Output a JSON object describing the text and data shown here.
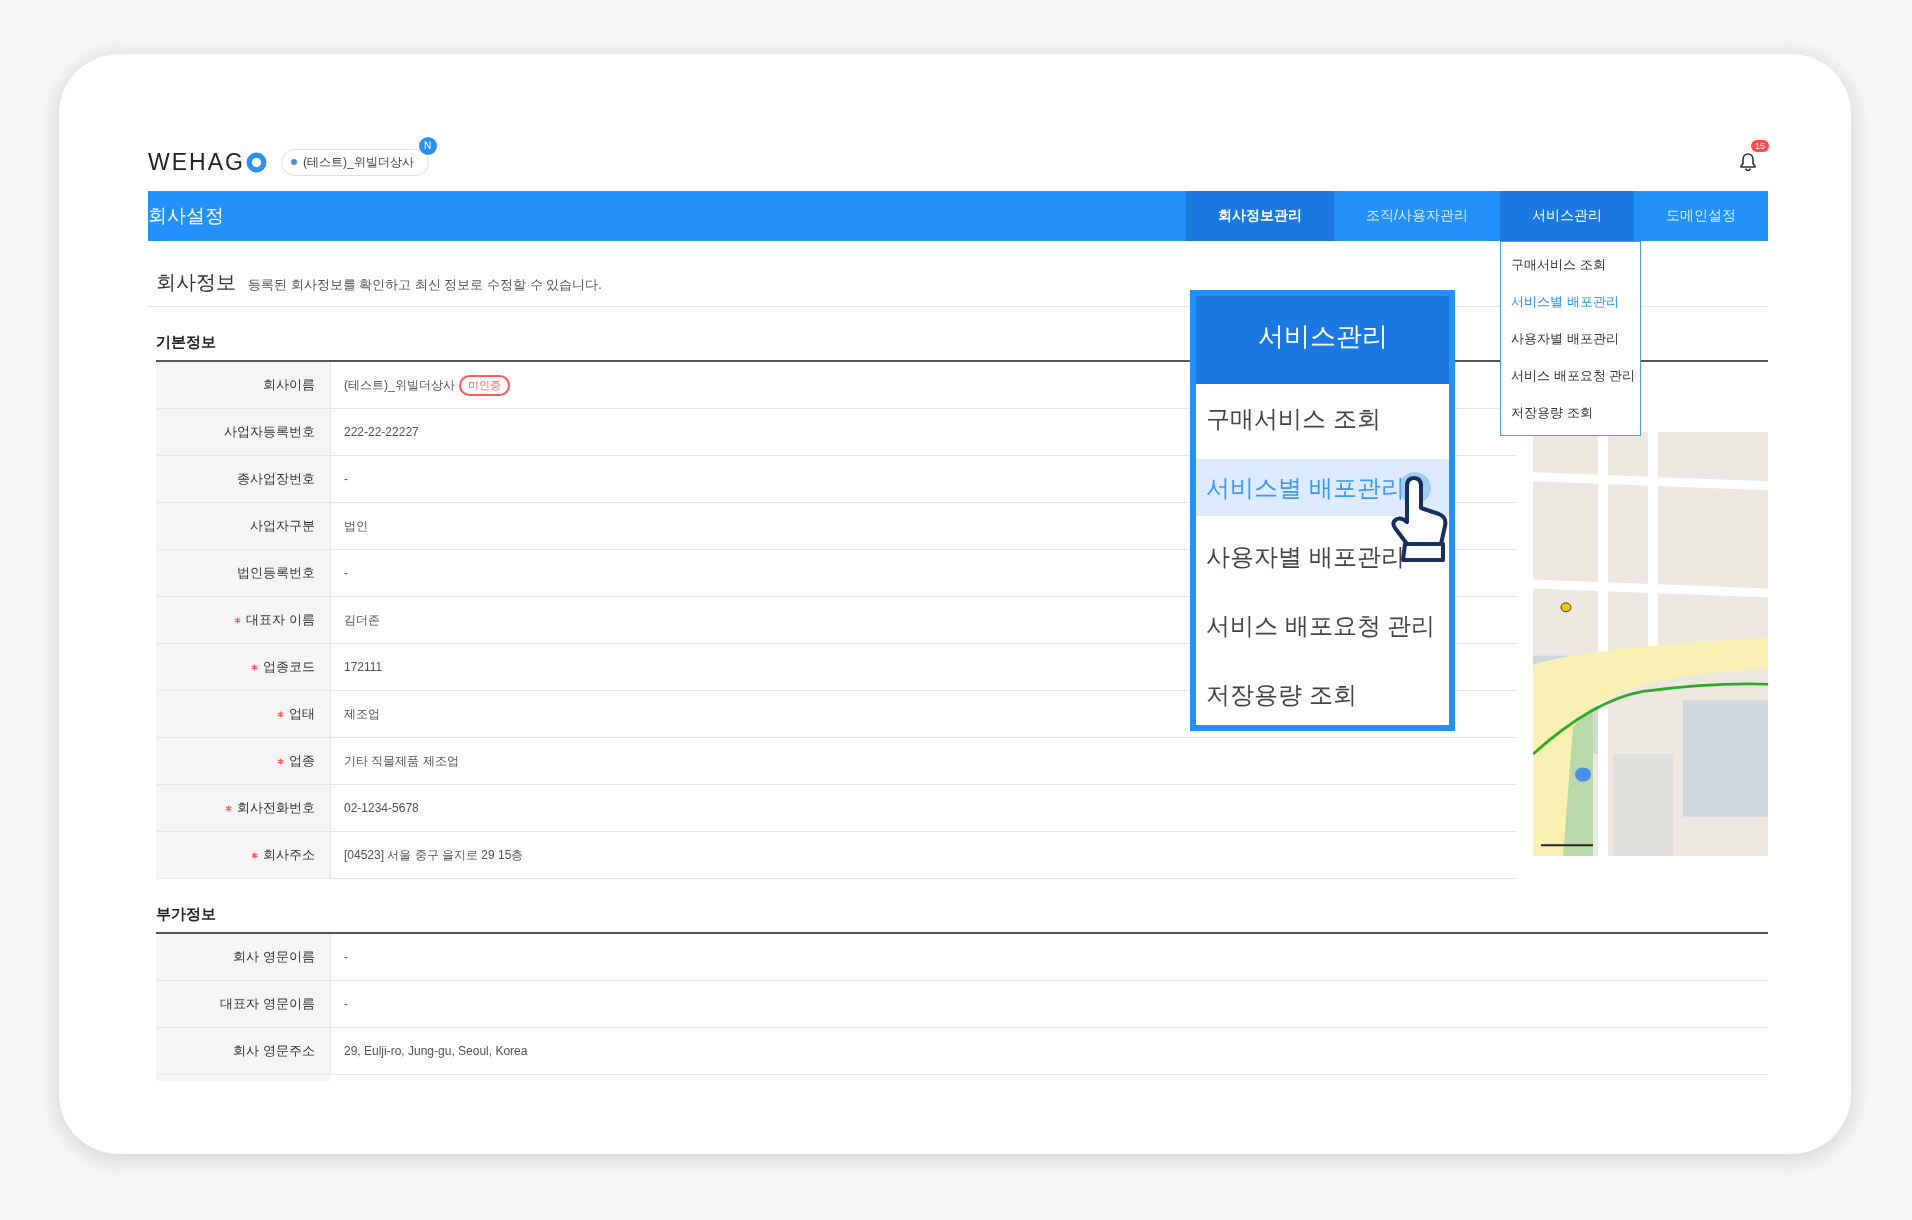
{
  "header": {
    "logo": "WEHAG",
    "company": "(테스트)_위빌더상사",
    "company_badge": "N",
    "notification_count": "15"
  },
  "title_bar": {
    "title": "회사설정",
    "tabs": [
      {
        "label": "회사정보관리",
        "selected": true,
        "expanded": false
      },
      {
        "label": "조직/사용자관리",
        "selected": false,
        "expanded": false
      },
      {
        "label": "서비스관리",
        "selected": false,
        "expanded": true,
        "items": [
          {
            "label": "구매서비스 조회",
            "selected": false
          },
          {
            "label": "서비스별 배포관리",
            "selected": true
          },
          {
            "label": "사용자별 배포관리",
            "selected": false
          },
          {
            "label": "서비스 배포요청 관리",
            "selected": false
          },
          {
            "label": "저장용량 조회",
            "selected": false
          }
        ]
      },
      {
        "label": "도메인설정",
        "selected": false,
        "expanded": false
      }
    ]
  },
  "page": {
    "title": "회사정보",
    "description": "등록된 회사정보를 확인하고 최신 정보로 수정할 수 있습니다."
  },
  "sections": [
    {
      "title": "기본정보",
      "map": true,
      "rows": [
        {
          "label": "회사이름",
          "value": "(테스트)_위빌더상사",
          "required": false,
          "badge": "미인증"
        },
        {
          "label": "사업자등록번호",
          "value": "222-22-22227",
          "required": false
        },
        {
          "label": "종사업장번호",
          "value": "-",
          "required": false
        },
        {
          "label": "사업자구분",
          "value": "법인",
          "required": false
        },
        {
          "label": "법인등록번호",
          "value": "-",
          "required": false
        },
        {
          "label": "대표자 이름",
          "value": "김더존",
          "required": true
        },
        {
          "label": "업종코드",
          "value": "172111",
          "required": true
        },
        {
          "label": "업태",
          "value": "제조업",
          "required": true
        },
        {
          "label": "업종",
          "value": "기타 직물제품 제조업",
          "required": true
        },
        {
          "label": "회사전화번호",
          "value": "02-1234-5678",
          "required": true
        },
        {
          "label": "회사주소",
          "value": "[04523] 서울 중구 을지로 29 15층",
          "required": true
        }
      ]
    },
    {
      "title": "부가정보",
      "map": false,
      "rows": [
        {
          "label": "회사 영문이름",
          "value": "-",
          "required": false
        },
        {
          "label": "대표자 영문이름",
          "value": "-",
          "required": false
        },
        {
          "label": "회사 영문주소",
          "value": "29, Eulji-ro, Jung-gu, Seoul, Korea",
          "required": false
        }
      ]
    }
  ],
  "callout": {
    "title": "서비스관리",
    "items": [
      {
        "label": "구매서비스 조회",
        "selected": false
      },
      {
        "label": "서비스별 배포관리",
        "selected": true
      },
      {
        "label": "사용자별 배포관리",
        "selected": false
      },
      {
        "label": "서비스 배포요청 관리",
        "selected": false
      },
      {
        "label": "저장용량 조회",
        "selected": false
      }
    ]
  }
}
